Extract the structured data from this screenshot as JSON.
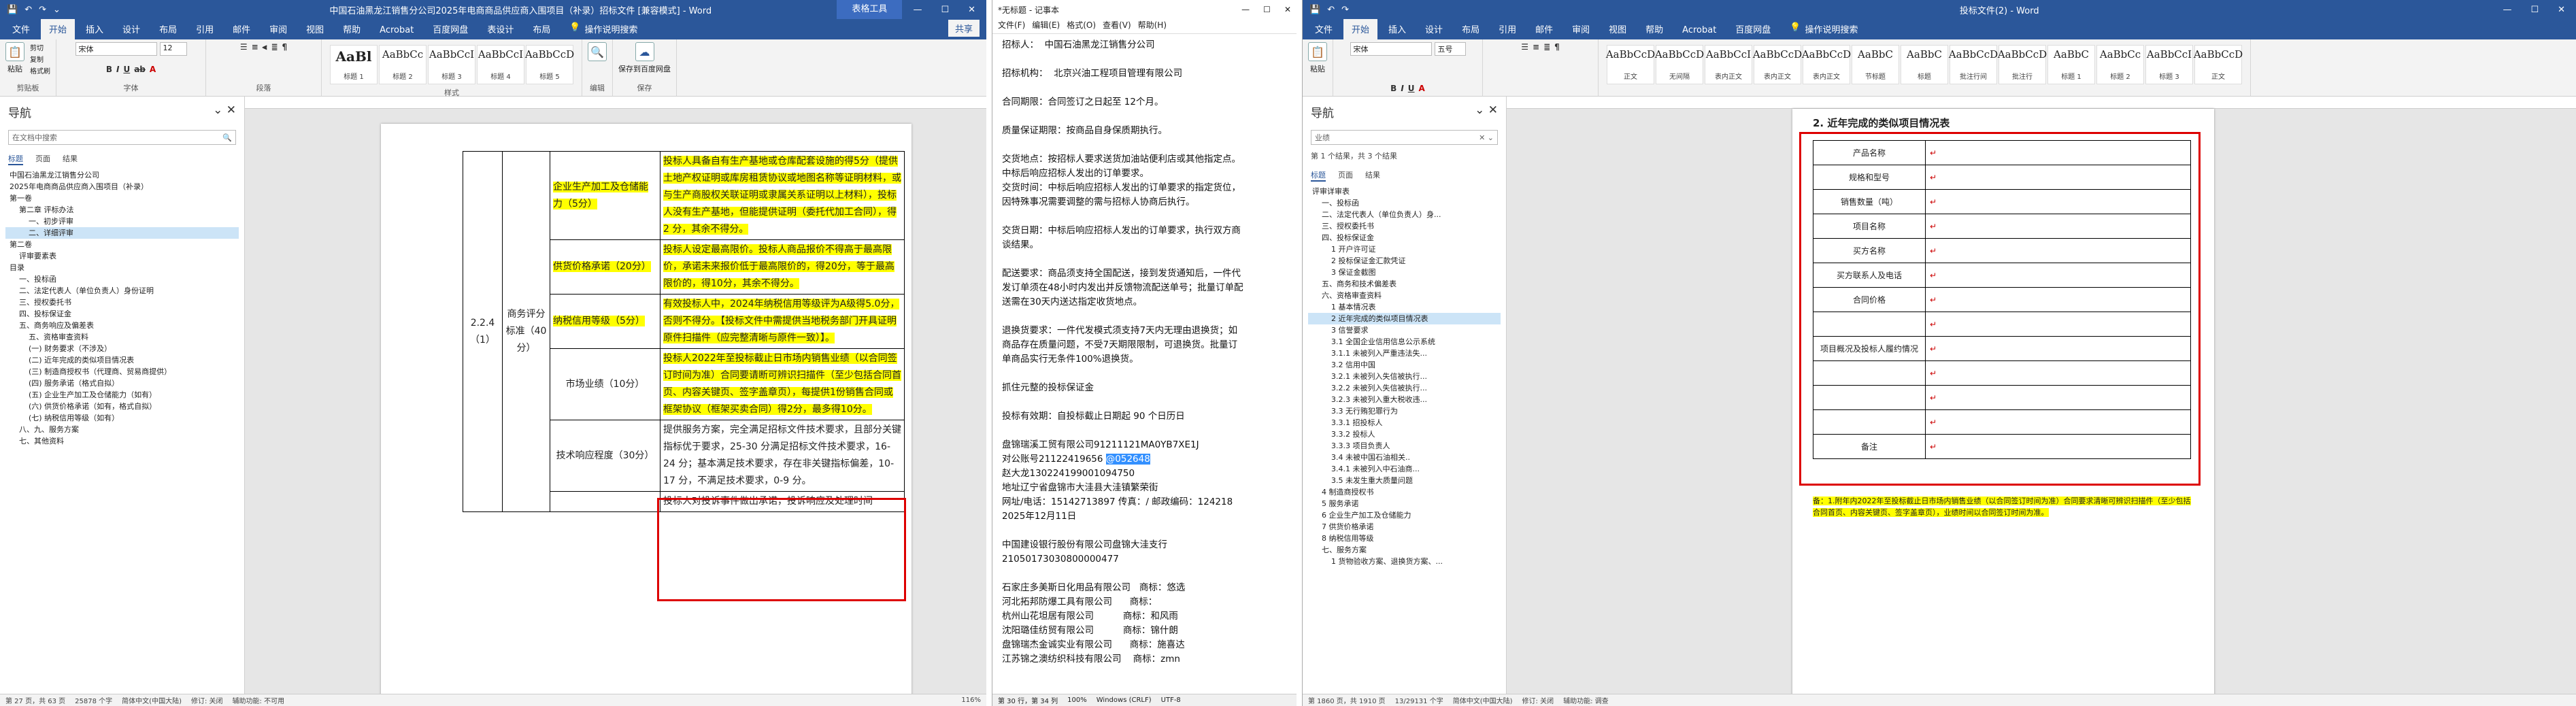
{
  "w1": {
    "qat": [
      "💾",
      "↶",
      "↷",
      "⌄"
    ],
    "title": "中国石油黑龙江销售分公司2025年电商商品供应商入围项目（补录）招标文件 [兼容模式] - Word",
    "ctx_tab": "表格工具",
    "tabs": [
      "文件",
      "开始",
      "插入",
      "设计",
      "布局",
      "引用",
      "邮件",
      "审阅",
      "视图",
      "帮助",
      "Acrobat",
      "百度网盘",
      "表设计",
      "布局"
    ],
    "tell": "操作说明搜索",
    "share": "共享",
    "ribbon": {
      "paste": "粘贴",
      "cut": "剪切",
      "copy": "复制",
      "painter": "格式刷",
      "clipboard": "剪贴板",
      "font_name": "宋体",
      "font_size": "12",
      "font_group": "字体",
      "para_group": "段落",
      "styles_group": "样式",
      "edit": "编辑",
      "save": "保存到百度网盘",
      "save_group": "保存",
      "styles": [
        {
          "p": "AaBl",
          "n": "标题 1"
        },
        {
          "p": "AaBbCc",
          "n": "标题 2"
        },
        {
          "p": "AaBbCcI",
          "n": "标题 3"
        },
        {
          "p": "AaBbCcI",
          "n": "标题 4"
        },
        {
          "p": "AaBbCcD",
          "n": "标题 5"
        }
      ]
    },
    "nav": {
      "title": "导航",
      "search": "在文档中搜索",
      "tabs": [
        "标题",
        "页面",
        "结果"
      ],
      "items": [
        {
          "t": "中国石油黑龙江销售分公司",
          "l": "l1"
        },
        {
          "t": "2025年电商商品供应商入围项目（补录）",
          "l": "l1"
        },
        {
          "t": "第一卷",
          "l": "l1"
        },
        {
          "t": "第二章 评标办法",
          "l": "l2"
        },
        {
          "t": "一、初步评审",
          "l": "l3"
        },
        {
          "t": "二、详细评审",
          "l": "l3",
          "hl": true
        },
        {
          "t": "第二卷",
          "l": "l1"
        },
        {
          "t": "评审要素表",
          "l": "l2"
        },
        {
          "t": "目录",
          "l": "l1"
        },
        {
          "t": "一、投标函",
          "l": "l2"
        },
        {
          "t": "二、法定代表人（单位负责人）身份证明",
          "l": "l2"
        },
        {
          "t": "三、授权委托书",
          "l": "l2"
        },
        {
          "t": "四、投标保证金",
          "l": "l2"
        },
        {
          "t": "五、商务响应及偏差表",
          "l": "l2"
        },
        {
          "t": "五、资格审查资料",
          "l": "l3"
        },
        {
          "t": "(一) 财务要求（不涉及）",
          "l": "l3"
        },
        {
          "t": "(二) 近年完成的类似项目情况表",
          "l": "l3"
        },
        {
          "t": "(三) 制造商授权书（代理商、贸易商提供）",
          "l": "l3"
        },
        {
          "t": "(四) 服务承诺（格式自拟）",
          "l": "l3"
        },
        {
          "t": "(五) 企业生产加工及仓储能力（如有）",
          "l": "l3"
        },
        {
          "t": "(六) 供货价格承诺（如有，格式自拟）",
          "l": "l3"
        },
        {
          "t": "(七) 纳税信用等级（如有）",
          "l": "l3"
        },
        {
          "t": "八、九、服务方案",
          "l": "l2"
        },
        {
          "t": "七、其他资料",
          "l": "l2"
        }
      ]
    },
    "table": {
      "num": "2.2.4（1）",
      "cat": "商务评分标准（40分）",
      "r1l": "企业生产加工及仓储能力（5分）",
      "r1t": "投标人具备自有生产基地或仓库配套设施的得5分（提供土地产权证明或库房租赁协议或地图名称等证明材料，或与生产商股权关联证明或隶属关系证明以上材料），投标人没有生产基地，但能提供证明（委托代加工合同），得 2 分，其余不得分。",
      "r2l": "供货价格承诺（20分）",
      "r2t": "投标人设定最高限价。投标人商品报价不得高于最高限价，承诺未来报价低于最高限价的，得20分，等于最高限价的，得10分，其余不得分。",
      "r3l": "纳税信用等级（5分）",
      "r3t": "有效投标人中，2024年纳税信用等级评为A级得5.0分，否则不得分。【投标文件中需提供当地税务部门开具证明原件扫描件（应完整清晰与原件一致）】。",
      "r4l": "市场业绩（10分）",
      "r4t": "投标人2022年至投标截止日市场内销售业绩（以合同签订时间为准）合同要请断可辨识扫描件（至少包括合同首页、内容关键页、签字盖章页），每提供1份销售合同或框架协议（框架买卖合同）得2分，最多得10分。",
      "r5l": "技术响应程度（30分）",
      "r5t": "提供服务方案，完全满足招标文件技术要求，且部分关键指标优于要求，25-30 分满足招标文件技术要求，16-24 分；基本满足技术要求，存在非关键指标偏差，10-17 分，不满足技术要求，0-9 分。",
      "r6t": "投标人对投诉事件做出承诺，投诉响应及处理时间"
    },
    "status": {
      "page": "第 27 页，共 63 页",
      "words": "25878 个字",
      "lang": "简体中文(中国大陆)",
      "mark": "修订: 关闭",
      "access": "辅助功能: 不可用",
      "zoom": "116%"
    }
  },
  "w2": {
    "title": "*无标题 - 记事本",
    "menu": [
      "文件(F)",
      "编辑(E)",
      "格式(O)",
      "查看(V)",
      "帮助(H)"
    ],
    "lines": [
      "招标人：  中国石油黑龙江销售分公司",
      "",
      "招标机构：  北京兴油工程项目管理有限公司",
      "",
      "合同期限：合同签订之日起至 12个月。",
      "",
      "质量保证期限：按商品自身保质期执行。",
      "",
      "交货地点：按招标人要求送货加油站便利店或其他指定点。",
      "中标后响应招标人发出的订单要求。",
      "交货时间：中标后响应招标人发出的订单要求的指定货位，",
      "因特殊事况需要调整的需与招标人协商后执行。",
      "",
      "交货日期：中标后响应招标人发出的订单要求，执行双方商",
      "谈结果。",
      "",
      "配送要求：商品须支持全国配送，接到发货通知后，一件代",
      "发订单须在48小时内发出并反馈物流配送单号；批量订单配",
      "送需在30天内送达指定收货地点。",
      "",
      "退换货要求：一件代发模式须支持7天内无理由退换货；如",
      "商品存在质量问题，不受7天期限限制，可退换货。批量订",
      "单商品实行无条件100%退换货。",
      "",
      "抓住元整的投标保证金",
      "",
      "投标有效期：自投标截止日期起 90 个日历日",
      "",
      "盘锦瑞溪工贸有限公司91211121MA0YB7XE1J",
      "对公账号21122419656 @052648",
      "赵大龙130224199001094750",
      "地址辽宁省盘锦市大洼县大洼镇繁荣街",
      "网址/电话：15142713897 传真：/ 邮政编码：124218",
      "2025年12月11日",
      "",
      "中国建设银行股份有限公司盘锦大洼支行",
      "21050173030800000477",
      "",
      "石家庄多美斯日化用品有限公司   商标：悠选",
      "河北拓邦防爆工具有限公司      商标：",
      "杭州山花坦居有限公司          商标：和风雨",
      "沈阳璐佳纺贸有限公司          商标：锦什朗",
      "盘锦瑞杰金诚实业有限公司      商标：施喜达",
      "江苏锦之澳纺织科技有限公司    商标：zmn"
    ],
    "sel_pre": "对公账号21122419656 ",
    "sel_text": "@052648",
    "status": [
      "第 30 行，第 34 列",
      "100%",
      "Windows (CRLF)",
      "UTF-8"
    ]
  },
  "w3": {
    "title": "投标文件(2) - Word",
    "tabs": [
      "文件",
      "开始",
      "插入",
      "设计",
      "布局",
      "引用",
      "邮件",
      "审阅",
      "视图",
      "帮助",
      "Acrobat",
      "百度网盘"
    ],
    "tell": "操作说明搜索",
    "ribbon": {
      "paste": "粘贴",
      "font_name": "宋体",
      "font_size": "五号",
      "styles": [
        {
          "p": "AaBbCcD",
          "n": "正文"
        },
        {
          "p": "AaBbCcD",
          "n": "无间隔"
        },
        {
          "p": "AaBbCcI",
          "n": "表内正文"
        },
        {
          "p": "AaBbCcD",
          "n": "表内正文"
        },
        {
          "p": "AaBbCcD",
          "n": "表内正文"
        },
        {
          "p": "AaBbC",
          "n": "节标题"
        },
        {
          "p": "AaBbC",
          "n": "标题"
        },
        {
          "p": "AaBbCcD",
          "n": "批注行间"
        },
        {
          "p": "AaBbCcD",
          "n": "批注行"
        },
        {
          "p": "AaBbC",
          "n": "标题 1"
        },
        {
          "p": "AaBbCc",
          "n": "标题 2"
        },
        {
          "p": "AaBbCcI",
          "n": "标题 3"
        },
        {
          "p": "AaBbCcD",
          "n": "正文"
        }
      ]
    },
    "nav": {
      "title": "导航",
      "search": "业绩",
      "result": "第 1 个结果，共 3 个结果",
      "tabs": [
        "标题",
        "页面",
        "结果"
      ],
      "items": [
        {
          "t": "评审详审表",
          "l": "l1"
        },
        {
          "t": "一、投标函",
          "l": "l2"
        },
        {
          "t": "二、法定代表人（单位负责人）身...",
          "l": "l2"
        },
        {
          "t": "三、授权委托书",
          "l": "l2"
        },
        {
          "t": "四、投标保证金",
          "l": "l2"
        },
        {
          "t": "1 开户许可证",
          "l": "l3"
        },
        {
          "t": "2 投标保证金汇款凭证",
          "l": "l3"
        },
        {
          "t": "3 保证金截图",
          "l": "l3"
        },
        {
          "t": "五、商务和技术偏差表",
          "l": "l2"
        },
        {
          "t": "六、资格审查资料",
          "l": "l2"
        },
        {
          "t": "1 基本情况表",
          "l": "l3"
        },
        {
          "t": "2 近年完成的类似项目情况表",
          "l": "l3",
          "hl": true
        },
        {
          "t": "3 信誉要求",
          "l": "l3"
        },
        {
          "t": "3.1 全国企业信用信息公示系统",
          "l": "l3"
        },
        {
          "t": "3.1.1 未被列入严重违法失...",
          "l": "l3"
        },
        {
          "t": "3.2 信用中国",
          "l": "l3"
        },
        {
          "t": "3.2.1 未被列入失信被执行...",
          "l": "l3"
        },
        {
          "t": "3.2.2 未被列入失信被执行...",
          "l": "l3"
        },
        {
          "t": "3.2.3 未被列入重大税收违...",
          "l": "l3"
        },
        {
          "t": "3.3 无行贿犯罪行为",
          "l": "l3"
        },
        {
          "t": "3.3.1 招投标人",
          "l": "l3"
        },
        {
          "t": "3.3.2 投标人",
          "l": "l3"
        },
        {
          "t": "3.3.3 项目负责人",
          "l": "l3"
        },
        {
          "t": "3.4 未被中国石油相关..",
          "l": "l3"
        },
        {
          "t": "3.4.1 未被列入中石油商...",
          "l": "l3"
        },
        {
          "t": "3.5 未发生重大质量问题",
          "l": "l3"
        },
        {
          "t": "4 制造商授权书",
          "l": "l2"
        },
        {
          "t": "5 服务承诺",
          "l": "l2"
        },
        {
          "t": "6 企业生产加工及仓储能力",
          "l": "l2"
        },
        {
          "t": "7 供货价格承诺",
          "l": "l2"
        },
        {
          "t": "8 纳税信用等级",
          "l": "l2"
        },
        {
          "t": "七、服务方案",
          "l": "l2"
        },
        {
          "t": "1 货物验收方案、退换货方案、...",
          "l": "l3"
        }
      ]
    },
    "heading": "2. 近年完成的类似项目情况表",
    "rows": [
      "产品名称",
      "规格和型号",
      "销售数量（吨）",
      "项目名称",
      "买方名称",
      "买方联系人及电话",
      "合同价格",
      "",
      "项目概况及投标人履约情况",
      "",
      "",
      "",
      "备注"
    ],
    "note": "备：1.附年内2022年至投标截止日市场内销售业绩（以合同签订时间为准）合同要求清晰可辨识扫描件（至少包括合同首页、内容关键页、签字盖章页），业绩时间以合同签订时间为准。",
    "status": {
      "page": "第 1860 页，共 1910 页",
      "words": "13/29131 个字",
      "lang": "简体中文(中国大陆)",
      "mark": "修订: 关闭",
      "access": "辅助功能: 调查"
    }
  }
}
